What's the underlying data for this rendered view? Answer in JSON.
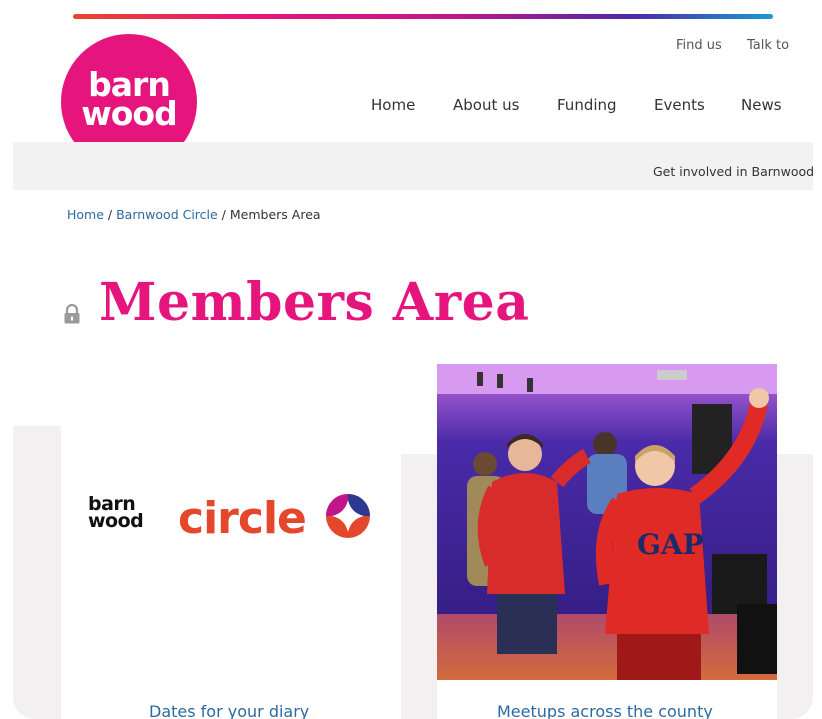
{
  "brand": {
    "logo_line1": "barn",
    "logo_line2": "wood",
    "logo_color": "#e5157d"
  },
  "utility_nav": {
    "find_us": "Find us",
    "talk_to": "Talk to"
  },
  "main_nav": {
    "home": "Home",
    "about": "About us",
    "funding": "Funding",
    "events": "Events",
    "news": "News"
  },
  "secondary_bar": {
    "get_involved": "Get involved in Barnwood"
  },
  "breadcrumb": {
    "home": "Home",
    "sep1": " / ",
    "circle": "Barnwood Circle",
    "sep2": " / ",
    "current": "Members Area"
  },
  "page": {
    "title": "Members Area",
    "title_color": "#e5157d",
    "lock_icon": "lock-icon"
  },
  "cards": [
    {
      "logo_small_line1": "barn",
      "logo_small_line2": "wood",
      "logo_word": "circle",
      "caption": "Dates for your diary"
    },
    {
      "image": "group-dancing-photo",
      "caption": "Meetups across the county"
    }
  ],
  "colors": {
    "link": "#2a6aa2",
    "circle_orange": "#e4472c"
  }
}
